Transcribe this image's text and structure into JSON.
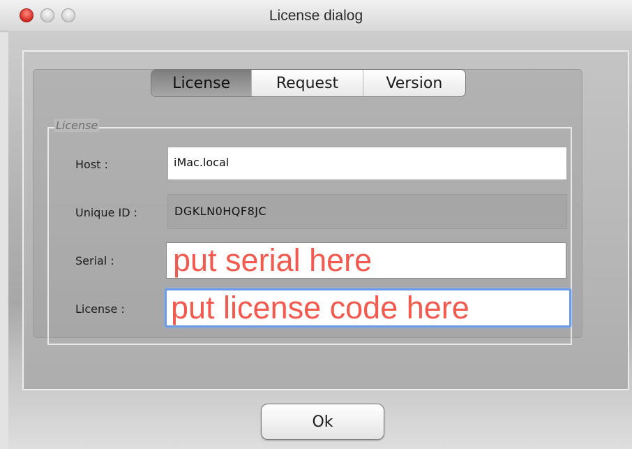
{
  "window": {
    "title": "License dialog"
  },
  "tabs": [
    {
      "label": "License",
      "active": true
    },
    {
      "label": "Request",
      "active": false
    },
    {
      "label": "Version",
      "active": false
    }
  ],
  "group": {
    "title": "License"
  },
  "fields": {
    "host": {
      "label": "Host :",
      "value": "iMac.local"
    },
    "unique_id": {
      "label": "Unique ID :",
      "value": "DGKLN0HQF8JC"
    },
    "serial": {
      "label": "Serial :",
      "value": "put serial here"
    },
    "license": {
      "label": "License :",
      "value": "put license code here"
    }
  },
  "buttons": {
    "ok": "Ok"
  },
  "colors": {
    "annotation_text": "#f25a4f",
    "focus_ring": "#6a9be4",
    "close_button": "#e0392f"
  }
}
